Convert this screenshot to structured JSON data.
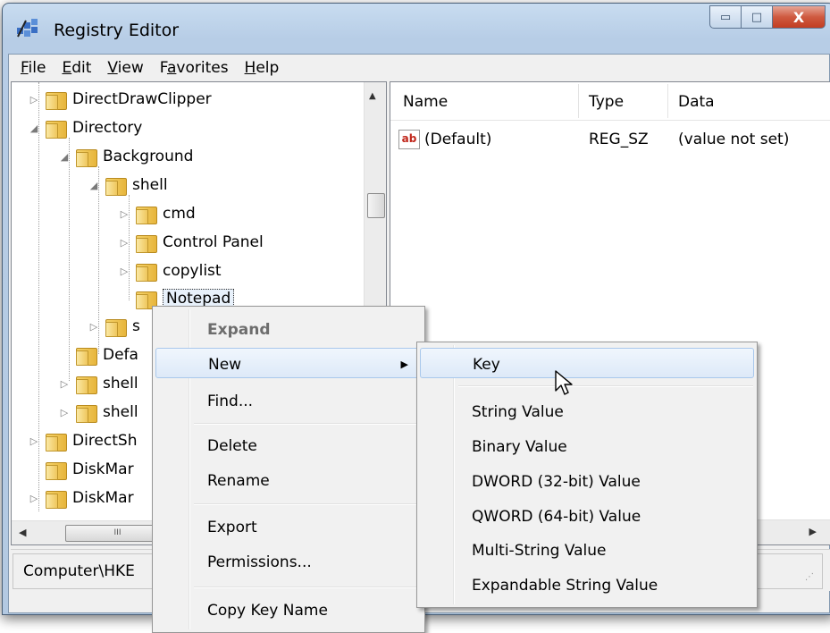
{
  "window": {
    "title": "Registry Editor",
    "caption_buttons": {
      "minimize": "▭",
      "maximize": "□",
      "close": "X"
    }
  },
  "menubar": [
    {
      "key": "F",
      "rest": "ile"
    },
    {
      "key": "E",
      "rest": "dit"
    },
    {
      "key": "V",
      "rest": "iew"
    },
    {
      "pre": "F",
      "key": "a",
      "rest": "vorites"
    },
    {
      "key": "H",
      "rest": "elp"
    }
  ],
  "tree": {
    "items": [
      {
        "label": "DirectDrawClipper"
      },
      {
        "label": "Directory"
      },
      {
        "label": "Background"
      },
      {
        "label": "shell"
      },
      {
        "label": "cmd"
      },
      {
        "label": "Control Panel"
      },
      {
        "label": "copylist"
      },
      {
        "label": "Notepad"
      },
      {
        "label": "s"
      },
      {
        "label": "Defa"
      },
      {
        "label": "shell"
      },
      {
        "label": "shell"
      },
      {
        "label": "DirectSh"
      },
      {
        "label": "DiskMar"
      },
      {
        "label": "DiskMar"
      }
    ],
    "hscroll_grip": "III"
  },
  "list": {
    "columns": {
      "name": "Name",
      "type": "Type",
      "data": "Data"
    },
    "rows": [
      {
        "icon": "ab",
        "name": "(Default)",
        "type": "REG_SZ",
        "data": "(value not set)"
      }
    ]
  },
  "status": {
    "path": "Computer\\HKE"
  },
  "context_menu": {
    "items": [
      {
        "label": "Expand"
      },
      {
        "label": "New"
      },
      {
        "label": "Find..."
      },
      {
        "label": "Delete"
      },
      {
        "label": "Rename"
      },
      {
        "label": "Export"
      },
      {
        "label": "Permissions..."
      },
      {
        "label": "Copy Key Name"
      }
    ]
  },
  "submenu": {
    "items": [
      {
        "label": "Key"
      },
      {
        "label": "String Value"
      },
      {
        "label": "Binary Value"
      },
      {
        "label": "DWORD (32-bit) Value"
      },
      {
        "label": "QWORD (64-bit) Value"
      },
      {
        "label": "Multi-String Value"
      },
      {
        "label": "Expandable String Value"
      }
    ]
  }
}
